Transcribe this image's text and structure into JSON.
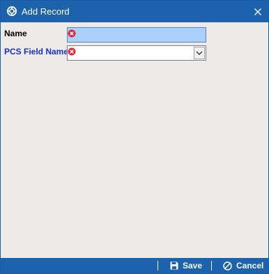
{
  "window": {
    "title": "Add Record",
    "close_glyph": "✕"
  },
  "form": {
    "name_label": "Name",
    "name_value": "",
    "pcs_label": "PCS Field Name",
    "pcs_value": ""
  },
  "footer": {
    "save_label": "Save",
    "cancel_label": "Cancel"
  },
  "colors": {
    "titlebar": "#1c62ad",
    "body": "#edeae8",
    "name_field": "#aad0fb",
    "pcs_label": "#1b2fd0",
    "error": "#e0283a"
  },
  "icons": {
    "app": "app-icon",
    "close": "close-icon",
    "error": "error-icon",
    "dropdown": "chevron-down-icon",
    "save": "save-icon",
    "cancel": "cancel-icon"
  }
}
